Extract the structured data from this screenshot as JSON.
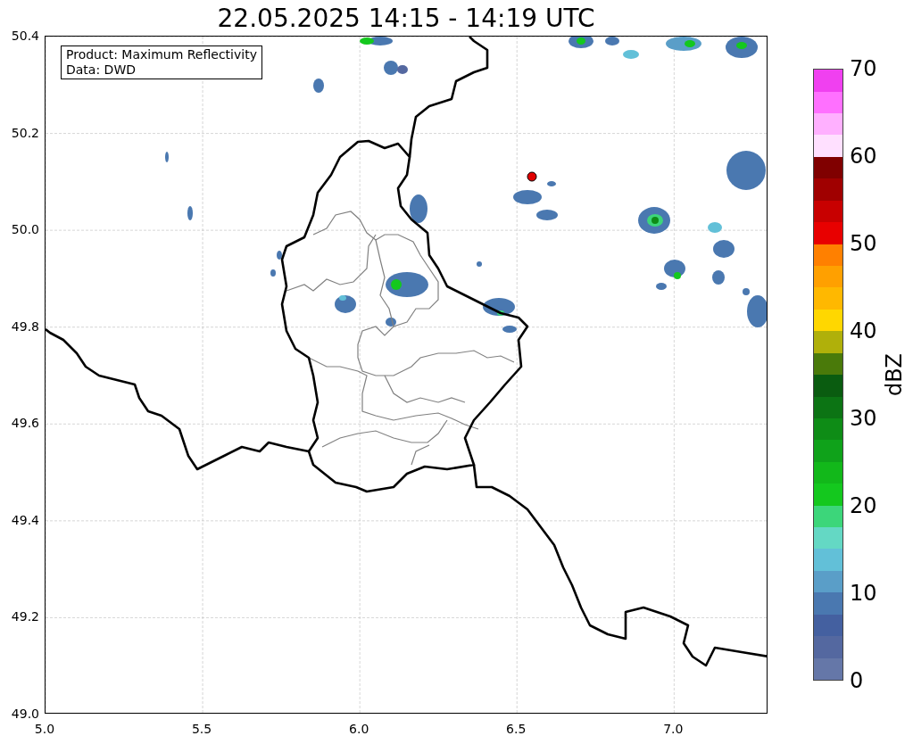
{
  "title": "22.05.2025 14:15 - 14:19 UTC",
  "info_box": {
    "lines": [
      "Product: Maximum Reflectivity",
      "Data: DWD"
    ]
  },
  "map": {
    "x_ticks": [
      "5.0",
      "5.5",
      "6.0",
      "6.5",
      "7.0"
    ],
    "y_ticks": [
      "50.4",
      "50.2",
      "50.0",
      "49.8",
      "49.6",
      "49.4",
      "49.2",
      "49.0"
    ]
  },
  "colorbar": {
    "label": "dBZ",
    "ticks": [
      "70",
      "60",
      "50",
      "40",
      "30",
      "20",
      "10",
      "0"
    ],
    "segments": [
      {
        "color": "#6577a8"
      },
      {
        "color": "#5468a0"
      },
      {
        "color": "#4460a0"
      },
      {
        "color": "#4a78b0"
      },
      {
        "color": "#5a9ec8"
      },
      {
        "color": "#62c0d8"
      },
      {
        "color": "#64d8c4"
      },
      {
        "color": "#3cd67a"
      },
      {
        "color": "#14c81e"
      },
      {
        "color": "#12b81a"
      },
      {
        "color": "#0fa21a"
      },
      {
        "color": "#0e8c16"
      },
      {
        "color": "#0c7414"
      },
      {
        "color": "#0a5c10"
      },
      {
        "color": "#4a7a0a"
      },
      {
        "color": "#b0b00a"
      },
      {
        "color": "#ffd700"
      },
      {
        "color": "#ffb800"
      },
      {
        "color": "#ffa000"
      },
      {
        "color": "#ff8000"
      },
      {
        "color": "#e80000"
      },
      {
        "color": "#c80000"
      },
      {
        "color": "#a00000"
      },
      {
        "color": "#800000"
      },
      {
        "color": "#ffe0ff"
      },
      {
        "color": "#ffb0ff"
      },
      {
        "color": "#ff70ff"
      },
      {
        "color": "#f040f0"
      }
    ]
  }
}
